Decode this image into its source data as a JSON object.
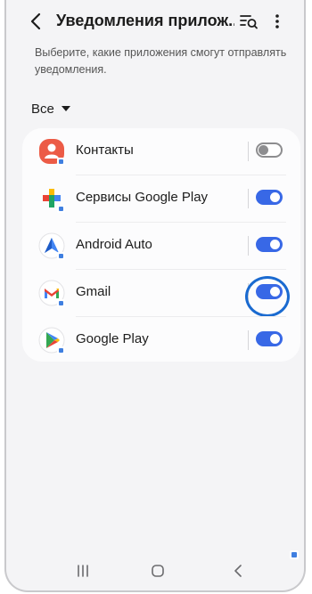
{
  "header": {
    "title": "Уведомления прилож...",
    "back_icon": "chevron-left-icon",
    "search_icon": "search-list-icon",
    "more_icon": "more-vertical-icon"
  },
  "description": "Выберите, какие приложения смогут отправлять уведомления.",
  "filter": {
    "selected": "Все"
  },
  "apps": [
    {
      "name": "Контакты",
      "icon": "contacts-icon",
      "enabled": false
    },
    {
      "name": "Сервисы Google Play",
      "icon": "google-play-services-icon",
      "enabled": true
    },
    {
      "name": "Android Auto",
      "icon": "android-auto-icon",
      "enabled": true
    },
    {
      "name": "Gmail",
      "icon": "gmail-icon",
      "enabled": true,
      "highlighted": true
    },
    {
      "name": "Google Play",
      "icon": "google-play-icon",
      "enabled": true
    }
  ],
  "colors": {
    "accent": "#3868e6",
    "highlight": "#1a6ad0",
    "background": "#f4f4f6"
  }
}
